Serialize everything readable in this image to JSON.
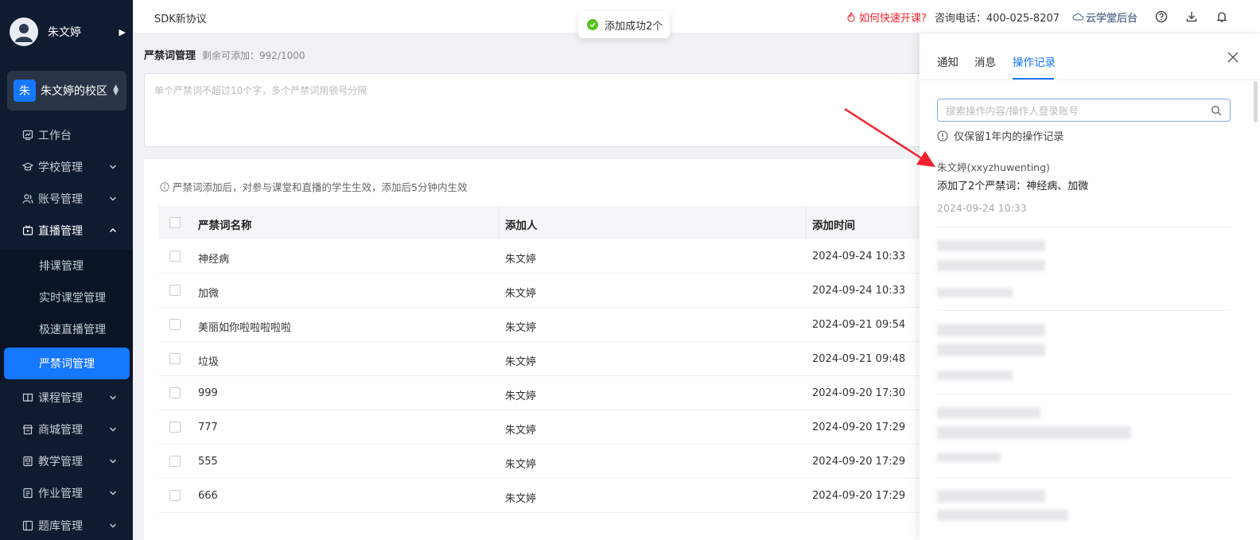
{
  "sidebar": {
    "user_name": "朱文婷",
    "campus_badge": "朱",
    "campus_name": "朱文婷的校区",
    "items": [
      {
        "label": "工作台"
      },
      {
        "label": "学校管理"
      },
      {
        "label": "账号管理"
      },
      {
        "label": "直播管理"
      },
      {
        "label": "课程管理"
      },
      {
        "label": "商城管理"
      },
      {
        "label": "教学管理"
      },
      {
        "label": "作业管理"
      },
      {
        "label": "题库管理"
      }
    ],
    "sub_items": [
      {
        "label": "排课管理"
      },
      {
        "label": "实时课堂管理"
      },
      {
        "label": "极速直播管理"
      },
      {
        "label": "严禁词管理"
      }
    ]
  },
  "topbar": {
    "left_title": "SDK新协议",
    "quick_start": "如何快速开课?",
    "hotline": "咨询电话：400-025-8207",
    "brand": "云学堂后台"
  },
  "toast": {
    "message": "添加成功2个"
  },
  "main": {
    "title": "严禁词管理",
    "remaining": "剩余可添加：992/1000",
    "input_placeholder": "单个严禁词不超过10个字，多个严禁词用顿号分隔",
    "notice": "严禁词添加后，对参与课堂和直播的学生生效，添加后5分钟内生效",
    "columns": [
      "严禁词名称",
      "添加人",
      "添加时间"
    ],
    "rows": [
      {
        "word": "神经病",
        "adder": "朱文婷",
        "time": "2024-09-24 10:33"
      },
      {
        "word": "加微",
        "adder": "朱文婷",
        "time": "2024-09-24 10:33"
      },
      {
        "word": "美丽如你啦啦啦啦啦",
        "adder": "朱文婷",
        "time": "2024-09-21 09:54"
      },
      {
        "word": "垃圾",
        "adder": "朱文婷",
        "time": "2024-09-21 09:48"
      },
      {
        "word": "999",
        "adder": "朱文婷",
        "time": "2024-09-20 17:30"
      },
      {
        "word": "777",
        "adder": "朱文婷",
        "time": "2024-09-20 17:29"
      },
      {
        "word": "555",
        "adder": "朱文婷",
        "time": "2024-09-20 17:29"
      },
      {
        "word": "666",
        "adder": "朱文婷",
        "time": "2024-09-20 17:29"
      }
    ]
  },
  "drawer": {
    "tabs": [
      {
        "label": "通知"
      },
      {
        "label": "消息"
      },
      {
        "label": "操作记录"
      }
    ],
    "search_placeholder": "搜索操作内容/操作人登录账号",
    "retention": "仅保留1年内的操作记录",
    "record": {
      "user": "朱文婷(xxyzhuwenting)",
      "action": "添加了2个严禁词：神经病、加微",
      "time": "2024-09-24 10:33"
    }
  },
  "colors": {
    "primary": "#1677ff",
    "sidebar_bg": "#0f1b30",
    "success": "#52c41a",
    "alert": "#f5222d",
    "annotation_arrow": "#f5222d"
  }
}
